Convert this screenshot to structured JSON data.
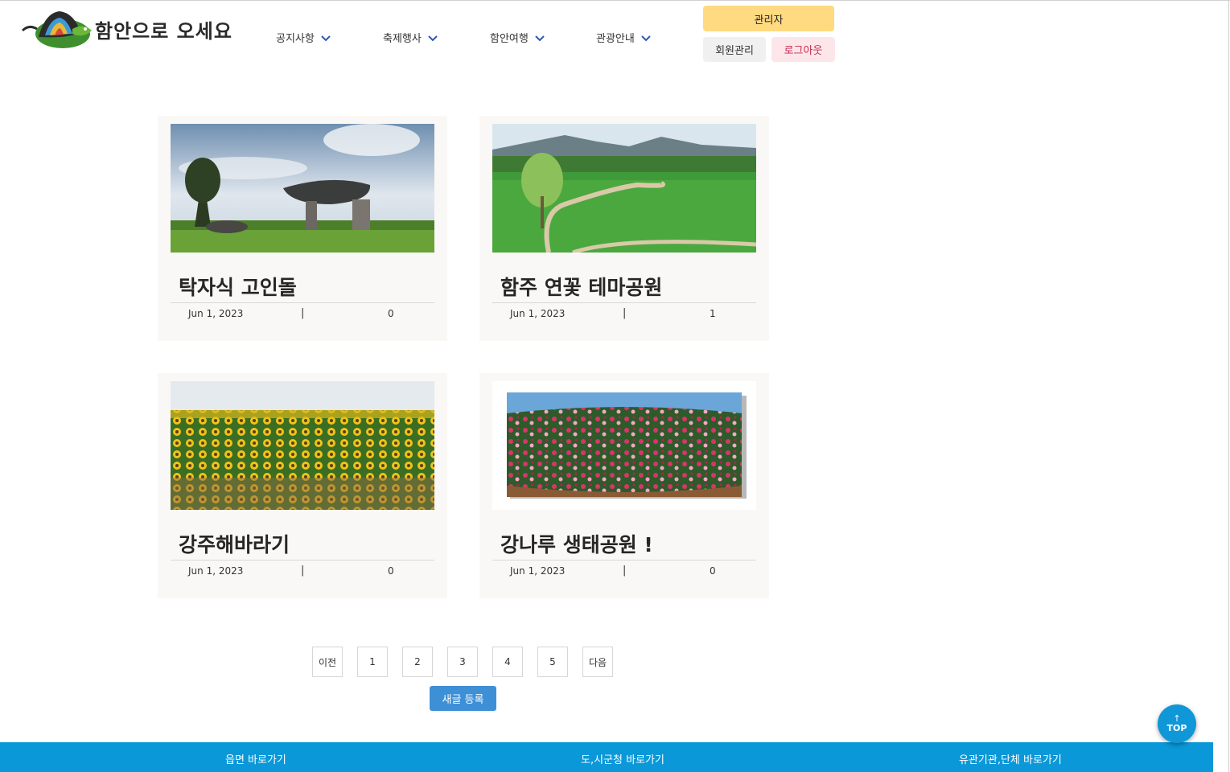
{
  "header": {
    "logo_text": "함안으로 오세요",
    "nav": [
      {
        "label": "공지사항",
        "icon": "chevron-down-icon"
      },
      {
        "label": "축제행사",
        "icon": "chevron-down-icon"
      },
      {
        "label": "함안여행",
        "icon": "chevron-down-icon"
      },
      {
        "label": "관광안내",
        "icon": "chevron-down-icon"
      }
    ],
    "admin_label": "관리자",
    "member_label": "회원관리",
    "logout_label": "로그아웃"
  },
  "posts": [
    {
      "title": "탁자식 고인돌",
      "date": "Jun 1, 2023",
      "separator": "|",
      "count": "0"
    },
    {
      "title": "함주 연꽃 테마공원",
      "date": "Jun 1, 2023",
      "separator": "|",
      "count": "1"
    },
    {
      "title": "강주해바라기",
      "date": "Jun 1, 2023",
      "separator": "|",
      "count": "0"
    },
    {
      "title": "강나루 생태공원 !",
      "date": "Jun 1, 2023",
      "separator": "|",
      "count": "0"
    }
  ],
  "pagination": {
    "prev": "이전",
    "pages": [
      "1",
      "2",
      "3",
      "4",
      "5"
    ],
    "next": "다음"
  },
  "new_post_label": "새글 등록",
  "top_button": {
    "arrow": "↑",
    "label": "TOP"
  },
  "footer": {
    "links": [
      "읍면 바로가기",
      "도,시군청 바로가기",
      "유관기관,단체 바로가기"
    ]
  },
  "colors": {
    "admin": "#ffda80",
    "logout_text": "#c8284a",
    "primary": "#3d8fd6",
    "footer": "#0a98d8"
  }
}
